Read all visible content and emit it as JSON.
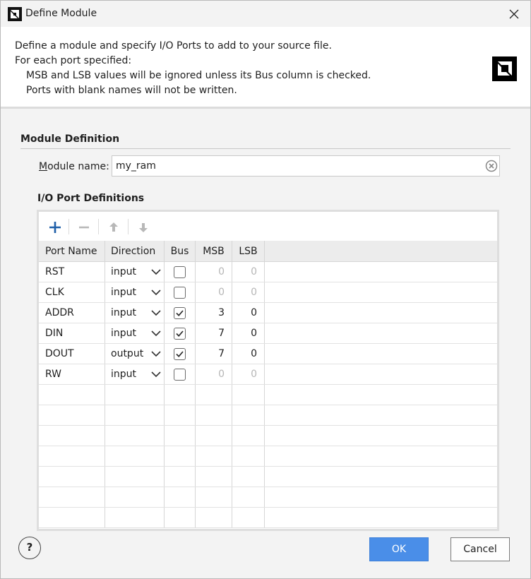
{
  "window": {
    "title": "Define Module"
  },
  "header": {
    "line1": "Define a module and specify I/O Ports to add to your source file.",
    "line2": "For each port specified:",
    "line3": "MSB and LSB values will be ignored unless its Bus column is checked.",
    "line4": "Ports with blank names will not be written.",
    "logo_icon": "amd-logo-icon"
  },
  "module_definition": {
    "title": "Module Definition",
    "name_label_mnemonic": "M",
    "name_label_rest": "odule name:",
    "name_value": "my_ram"
  },
  "io_ports": {
    "title": "I/O Port Definitions",
    "toolbar": [
      "add-icon",
      "remove-icon",
      "move-up-icon",
      "move-down-icon"
    ],
    "columns": [
      "Port Name",
      "Direction",
      "Bus",
      "MSB",
      "LSB"
    ],
    "rows": [
      {
        "name": "RST",
        "direction": "input",
        "bus": false,
        "msb": "0",
        "lsb": "0"
      },
      {
        "name": "CLK",
        "direction": "input",
        "bus": false,
        "msb": "0",
        "lsb": "0"
      },
      {
        "name": "ADDR",
        "direction": "input",
        "bus": true,
        "msb": "3",
        "lsb": "0"
      },
      {
        "name": "DIN",
        "direction": "input",
        "bus": true,
        "msb": "7",
        "lsb": "0"
      },
      {
        "name": "DOUT",
        "direction": "output",
        "bus": true,
        "msb": "7",
        "lsb": "0"
      },
      {
        "name": "RW",
        "direction": "input",
        "bus": false,
        "msb": "0",
        "lsb": "0"
      }
    ],
    "empty_rows": 7
  },
  "footer": {
    "help_label": "?",
    "ok_label": "OK",
    "cancel_label": "Cancel"
  },
  "colors": {
    "accent": "#4a8ee8",
    "add_icon": "#1f5fa8",
    "disabled_text": "#b6b6b6"
  }
}
